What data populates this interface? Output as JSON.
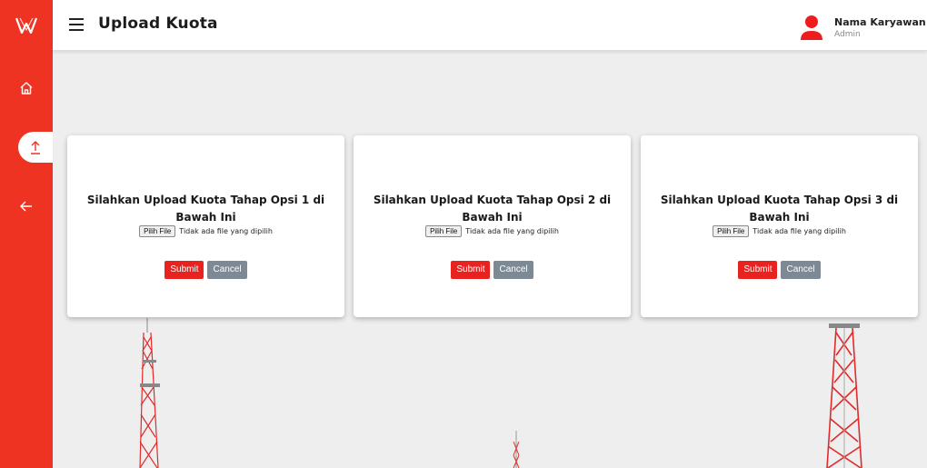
{
  "header": {
    "title": "Upload Kuota",
    "user_name": "Nama Karyawan",
    "user_role": "Admin"
  },
  "sidebar": {
    "items": [
      {
        "icon": "home-icon"
      },
      {
        "icon": "upload-icon",
        "active": true
      },
      {
        "icon": "arrow-left-icon"
      }
    ]
  },
  "cards": [
    {
      "title": "Silahkan Upload Kuota Tahap Opsi 1 di Bawah Ini",
      "file_button": "Pilih File",
      "file_status": "Tidak ada file yang dipilih",
      "submit": "Submit",
      "cancel": "Cancel"
    },
    {
      "title": "Silahkan Upload Kuota Tahap Opsi 2 di Bawah Ini",
      "file_button": "Pilih File",
      "file_status": "Tidak ada file yang dipilih",
      "submit": "Submit",
      "cancel": "Cancel"
    },
    {
      "title": "Silahkan Upload Kuota Tahap Opsi 3 di Bawah Ini",
      "file_button": "Pilih File",
      "file_status": "Tidak ada file yang dipilih",
      "submit": "Submit",
      "cancel": "Cancel"
    }
  ],
  "colors": {
    "primary": "#ee3323",
    "submit": "#e8231f",
    "cancel": "#7d8995"
  }
}
